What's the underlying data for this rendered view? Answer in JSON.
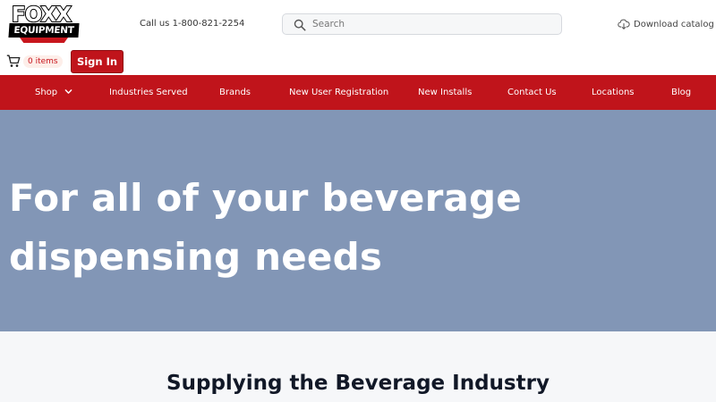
{
  "header": {
    "logo_top": "FOXX",
    "logo_bottom": "EQUIPMENT",
    "call_us": "Call us 1-800-821-2254",
    "search_placeholder": "Search",
    "download_label": "Download catalog",
    "cart_count": "0 items",
    "sign_in_label": "Sign In"
  },
  "nav": {
    "items": [
      {
        "label": "Shop",
        "icon": "chevron-down-icon"
      },
      {
        "label": "Industries Served"
      },
      {
        "label": "Brands"
      },
      {
        "label": "New User Registration"
      },
      {
        "label": "New Installs"
      },
      {
        "label": "Contact Us"
      },
      {
        "label": "Locations"
      },
      {
        "label": "Blog"
      }
    ]
  },
  "hero": {
    "headline": "For all of your beverage dispensing needs"
  },
  "section": {
    "title": "Supplying the Beverage Industry"
  },
  "colors": {
    "brand_red": "#c0141b",
    "hero_bg": "#8296b6",
    "section_bg": "#f6f7f9"
  }
}
